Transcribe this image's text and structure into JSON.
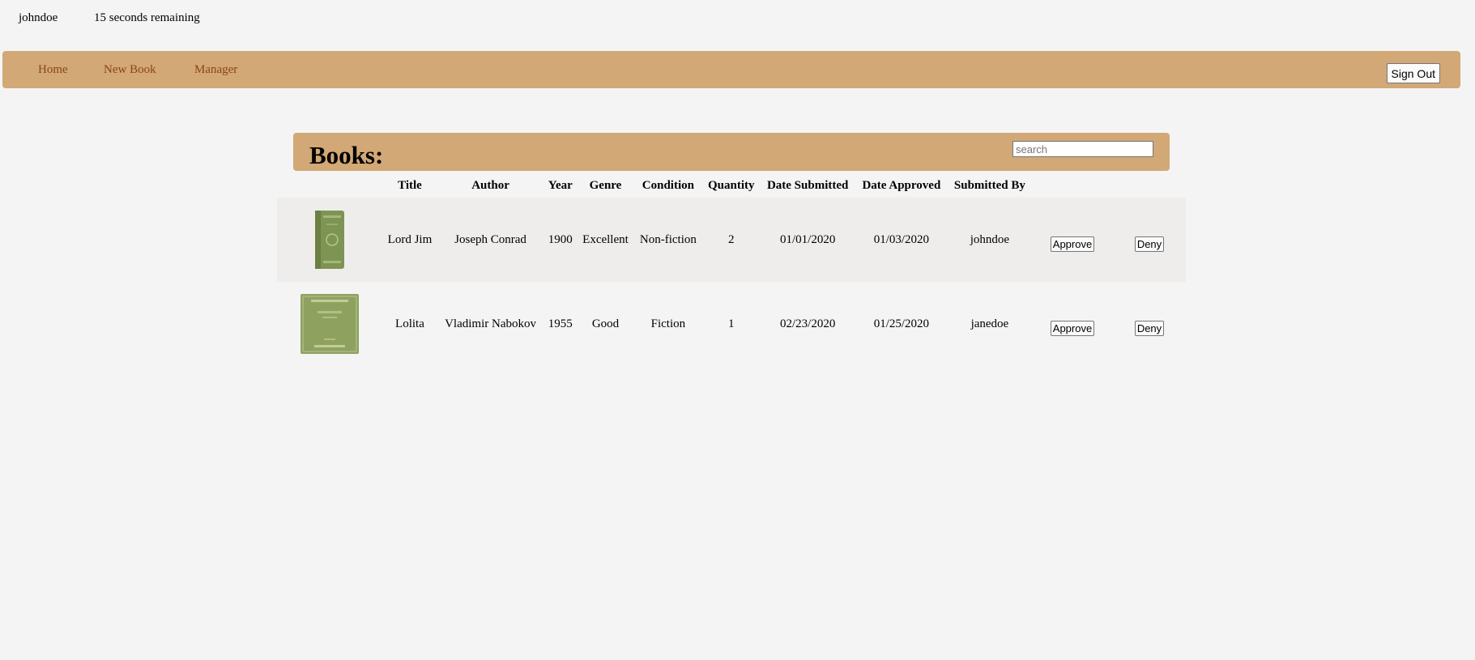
{
  "header": {
    "username": "johndoe",
    "timer": "15 seconds remaining"
  },
  "nav": {
    "items": [
      {
        "label": "Home"
      },
      {
        "label": "New Book"
      },
      {
        "label": "Manager"
      }
    ],
    "signout_label": "Sign Out"
  },
  "books_panel": {
    "title": "Books:",
    "search_placeholder": "search"
  },
  "table": {
    "columns": [
      "Title",
      "Author",
      "Year",
      "Genre",
      "Condition",
      "Quantity",
      "Date Submitted",
      "Date Approved",
      "Submitted By"
    ],
    "rows": [
      {
        "title": "Lord Jim",
        "author": "Joseph Conrad",
        "year": "1900",
        "genre": "Excellent",
        "condition": "Non-fiction",
        "quantity": "2",
        "date_submitted": "01/01/2020",
        "date_approved": "01/03/2020",
        "submitted_by": "johndoe",
        "approve_label": "Approve",
        "deny_label": "Deny"
      },
      {
        "title": "Lolita",
        "author": "Vladimir Nabokov",
        "year": "1955",
        "genre": "Good",
        "condition": "Fiction",
        "quantity": "1",
        "date_submitted": "02/23/2020",
        "date_approved": "01/25/2020",
        "submitted_by": "janedoe",
        "approve_label": "Approve",
        "deny_label": "Deny"
      }
    ]
  },
  "colors": {
    "accent": "#d2a876",
    "nav_link": "#8b4513",
    "background": "#f4f4f4",
    "row_shade": "#eeedeb",
    "book_cover": "#7d9452"
  }
}
